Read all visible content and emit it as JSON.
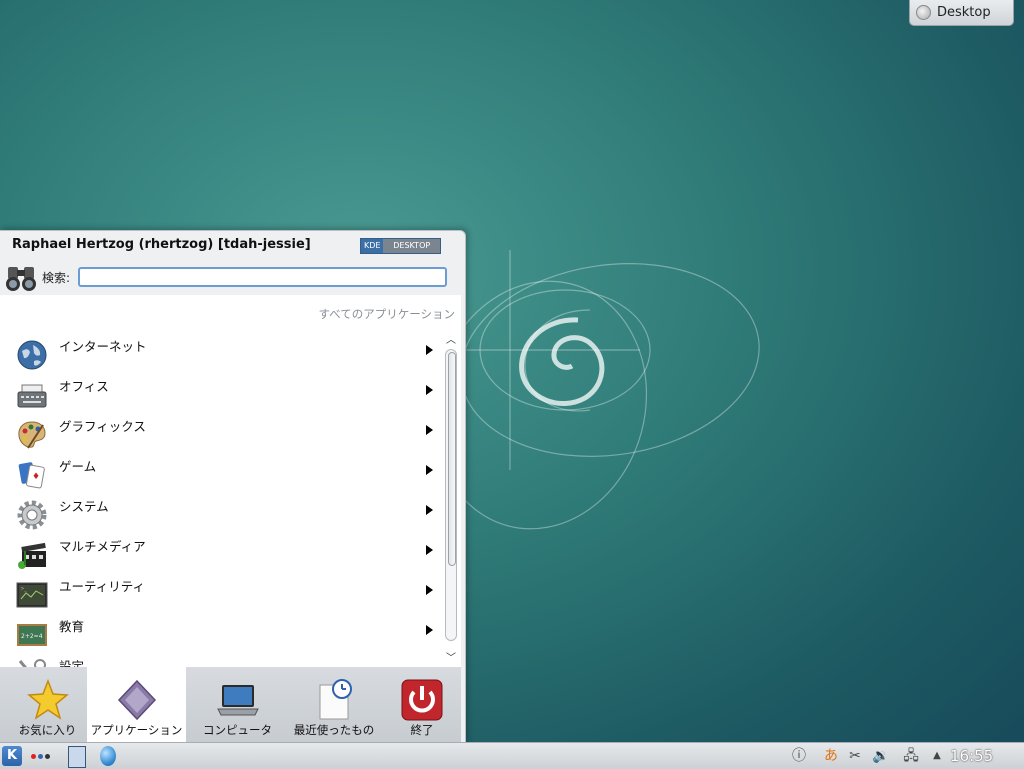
{
  "desktop": {
    "cashew_label": "Desktop"
  },
  "kickoff": {
    "user_header": "Raphael Hertzog (rhertzog) [tdah-jessie]",
    "badge": {
      "kde": "KDE",
      "desktop": "DESKTOP"
    },
    "search": {
      "label": "検索:",
      "value": ""
    },
    "all_apps_label": "すべてのアプリケーション",
    "apps": [
      {
        "label": "インターネット",
        "icon": "globe-icon"
      },
      {
        "label": "オフィス",
        "icon": "typewriter-icon"
      },
      {
        "label": "グラフィックス",
        "icon": "palette-icon"
      },
      {
        "label": "ゲーム",
        "icon": "cards-icon"
      },
      {
        "label": "システム",
        "icon": "gear-icon"
      },
      {
        "label": "マルチメディア",
        "icon": "clapperboard-icon"
      },
      {
        "label": "ユーティリティ",
        "icon": "monitor-icon"
      },
      {
        "label": "教育",
        "icon": "chalkboard-icon"
      },
      {
        "label": "設定",
        "icon": "tools-icon"
      }
    ],
    "tabs": [
      {
        "label": "お気に入り",
        "icon": "star-icon"
      },
      {
        "label": "アプリケーション",
        "icon": "diamond-icon"
      },
      {
        "label": "コンピュータ",
        "icon": "laptop-icon"
      },
      {
        "label": "最近使ったもの",
        "icon": "recent-document-icon"
      },
      {
        "label": "終了",
        "icon": "power-icon"
      }
    ]
  },
  "taskbar": {
    "kmenu_glyph": "K",
    "clock": "16:55",
    "tray_icons": [
      "info-icon",
      "input-method-icon",
      "clipboard-scissors-icon",
      "volume-icon",
      "network-icon",
      "expand-arrow-icon"
    ]
  },
  "colors": {
    "accent": "#3d6fa7",
    "power_red": "#c0262b"
  }
}
